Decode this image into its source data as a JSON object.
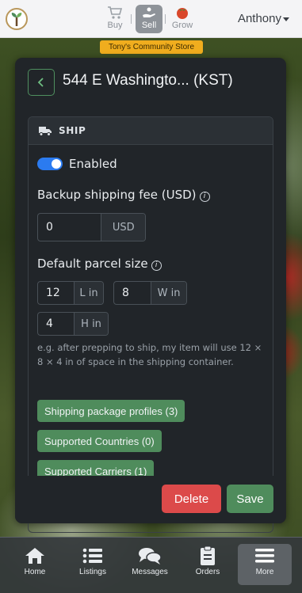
{
  "header": {
    "nav": [
      {
        "label": "Buy",
        "icon": "cart-icon",
        "active": false
      },
      {
        "label": "Sell",
        "icon": "hand-seed-icon",
        "active": true
      },
      {
        "label": "Grow",
        "icon": "tomato-icon",
        "active": false
      }
    ],
    "username": "Anthony",
    "store_badge": "Tony's Community Store"
  },
  "card": {
    "title": "544 E Washingto... (KST)",
    "section": {
      "label": "SHIP",
      "enabled_label": "Enabled",
      "enabled": true,
      "backup_fee_label": "Backup shipping fee (USD)",
      "backup_fee_value": "0",
      "backup_fee_unit": "USD",
      "parcel_label": "Default parcel size",
      "length_value": "12",
      "length_unit": "L in",
      "width_value": "8",
      "width_unit": "W in",
      "height_value": "4",
      "height_unit": "H in",
      "help_text": "e.g. after prepping to ship, my item will use 12 × 8 × 4 in of space in the shipping container.",
      "buttons": [
        {
          "label": "Shipping package profiles (3)"
        },
        {
          "label": "Supported Countries (0)"
        },
        {
          "label": "Supported Carriers (1)"
        }
      ]
    },
    "delete_label": "Delete",
    "save_label": "Save"
  },
  "bottom_nav": [
    {
      "label": "Home",
      "icon": "home-icon",
      "active": false
    },
    {
      "label": "Listings",
      "icon": "list-icon",
      "active": false
    },
    {
      "label": "Messages",
      "icon": "chat-icon",
      "active": false
    },
    {
      "label": "Orders",
      "icon": "clipboard-icon",
      "active": false
    },
    {
      "label": "More",
      "icon": "menu-icon",
      "active": true
    }
  ],
  "colors": {
    "accent_green": "#4f8c5c",
    "danger_red": "#dc4a4a",
    "toggle_blue": "#2b7bf0",
    "badge_orange": "#f0ad1e"
  }
}
